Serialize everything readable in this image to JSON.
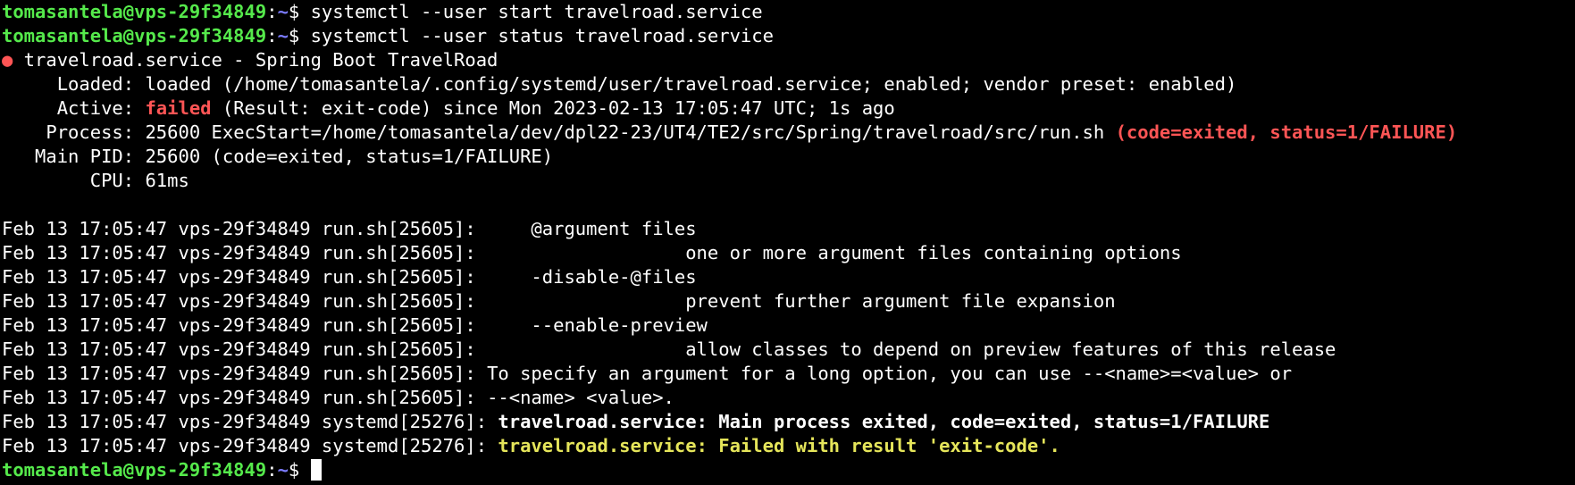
{
  "prompt": {
    "user_host": "tomasantela@vps-29f34849",
    "sep": ":",
    "path": "~",
    "symbol": "$ "
  },
  "commands": [
    "systemctl --user start travelroad.service",
    "systemctl --user status travelroad.service"
  ],
  "status": {
    "dot": "●",
    "title": " travelroad.service - Spring Boot TravelRoad",
    "loaded_label": "     Loaded: ",
    "loaded_value": "loaded (/home/tomasantela/.config/systemd/user/travelroad.service; enabled; vendor preset: enabled)",
    "active_label": "     Active: ",
    "active_state": "failed",
    "active_rest": " (Result: exit-code) since Mon 2023-02-13 17:05:47 UTC; 1s ago",
    "process_label": "    Process: ",
    "process_value": "25600 ExecStart=/home/tomasantela/dev/dpl22-23/UT4/TE2/src/Spring/travelroad/src/run.sh ",
    "process_result": "(code=exited, status=1/FAILURE)",
    "mainpid_label": "   Main PID: ",
    "mainpid_value": "25600 (code=exited, status=1/FAILURE)",
    "cpu_label": "        CPU: ",
    "cpu_value": "61ms"
  },
  "log_prefix_run": "Feb 13 17:05:47 vps-29f34849 run.sh[25605]: ",
  "log_lines": [
    "    @argument files",
    "                  one or more argument files containing options",
    "    -disable-@files",
    "                  prevent further argument file expansion",
    "    --enable-preview",
    "                  allow classes to depend on preview features of this release",
    "To specify an argument for a long option, you can use --<name>=<value> or",
    "--<name> <value>."
  ],
  "log_prefix_systemd": "Feb 13 17:05:47 vps-29f34849 systemd[25276]: ",
  "systemd_msgs": [
    "travelroad.service: Main process exited, code=exited, status=1/FAILURE",
    "travelroad.service: Failed with result 'exit-code'."
  ],
  "colors": {
    "background": "#000000",
    "prompt_user": "#55e94b",
    "prompt_path": "#7c7cff",
    "error_red": "#ff5555",
    "warning_yellow": "#e5e55a"
  }
}
